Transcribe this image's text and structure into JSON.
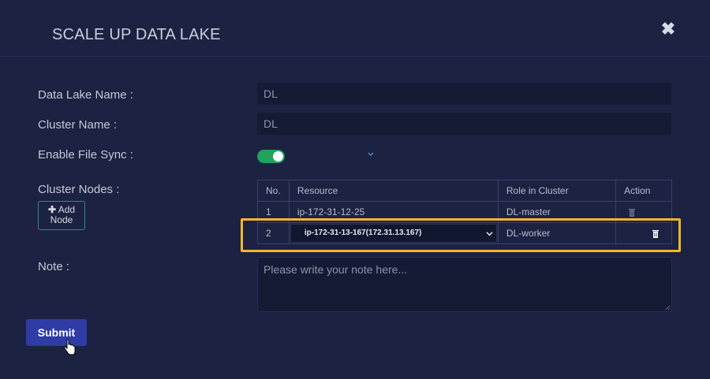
{
  "modal": {
    "title": "SCALE UP DATA LAKE",
    "close_icon": "close-icon"
  },
  "form": {
    "data_lake_name_label": "Data Lake Name :",
    "data_lake_name_value": "DL",
    "cluster_name_label": "Cluster Name :",
    "cluster_name_value": "DL",
    "enable_file_sync_label": "Enable File Sync :",
    "enable_file_sync_on": true,
    "cluster_nodes_label": "Cluster Nodes :",
    "add_node_label_1": "Add",
    "add_node_label_2": "Node",
    "note_label": "Note :",
    "note_placeholder": "Please write your note here...",
    "submit_label": "Submit"
  },
  "nodes_table": {
    "headers": [
      "No.",
      "Resource",
      "Role in Cluster",
      "Action"
    ],
    "rows": [
      {
        "no": "1",
        "resource": "ip-172-31-12-25",
        "role": "DL-master"
      },
      {
        "no": "2",
        "resource": "ip-172-31-13-167(172.31.13.167)",
        "role": "DL-worker"
      }
    ]
  },
  "colors": {
    "background": "#1c2241",
    "toggle_on": "#1fa35d",
    "submit": "#2f3ca5",
    "highlight": "#f2b72a"
  }
}
